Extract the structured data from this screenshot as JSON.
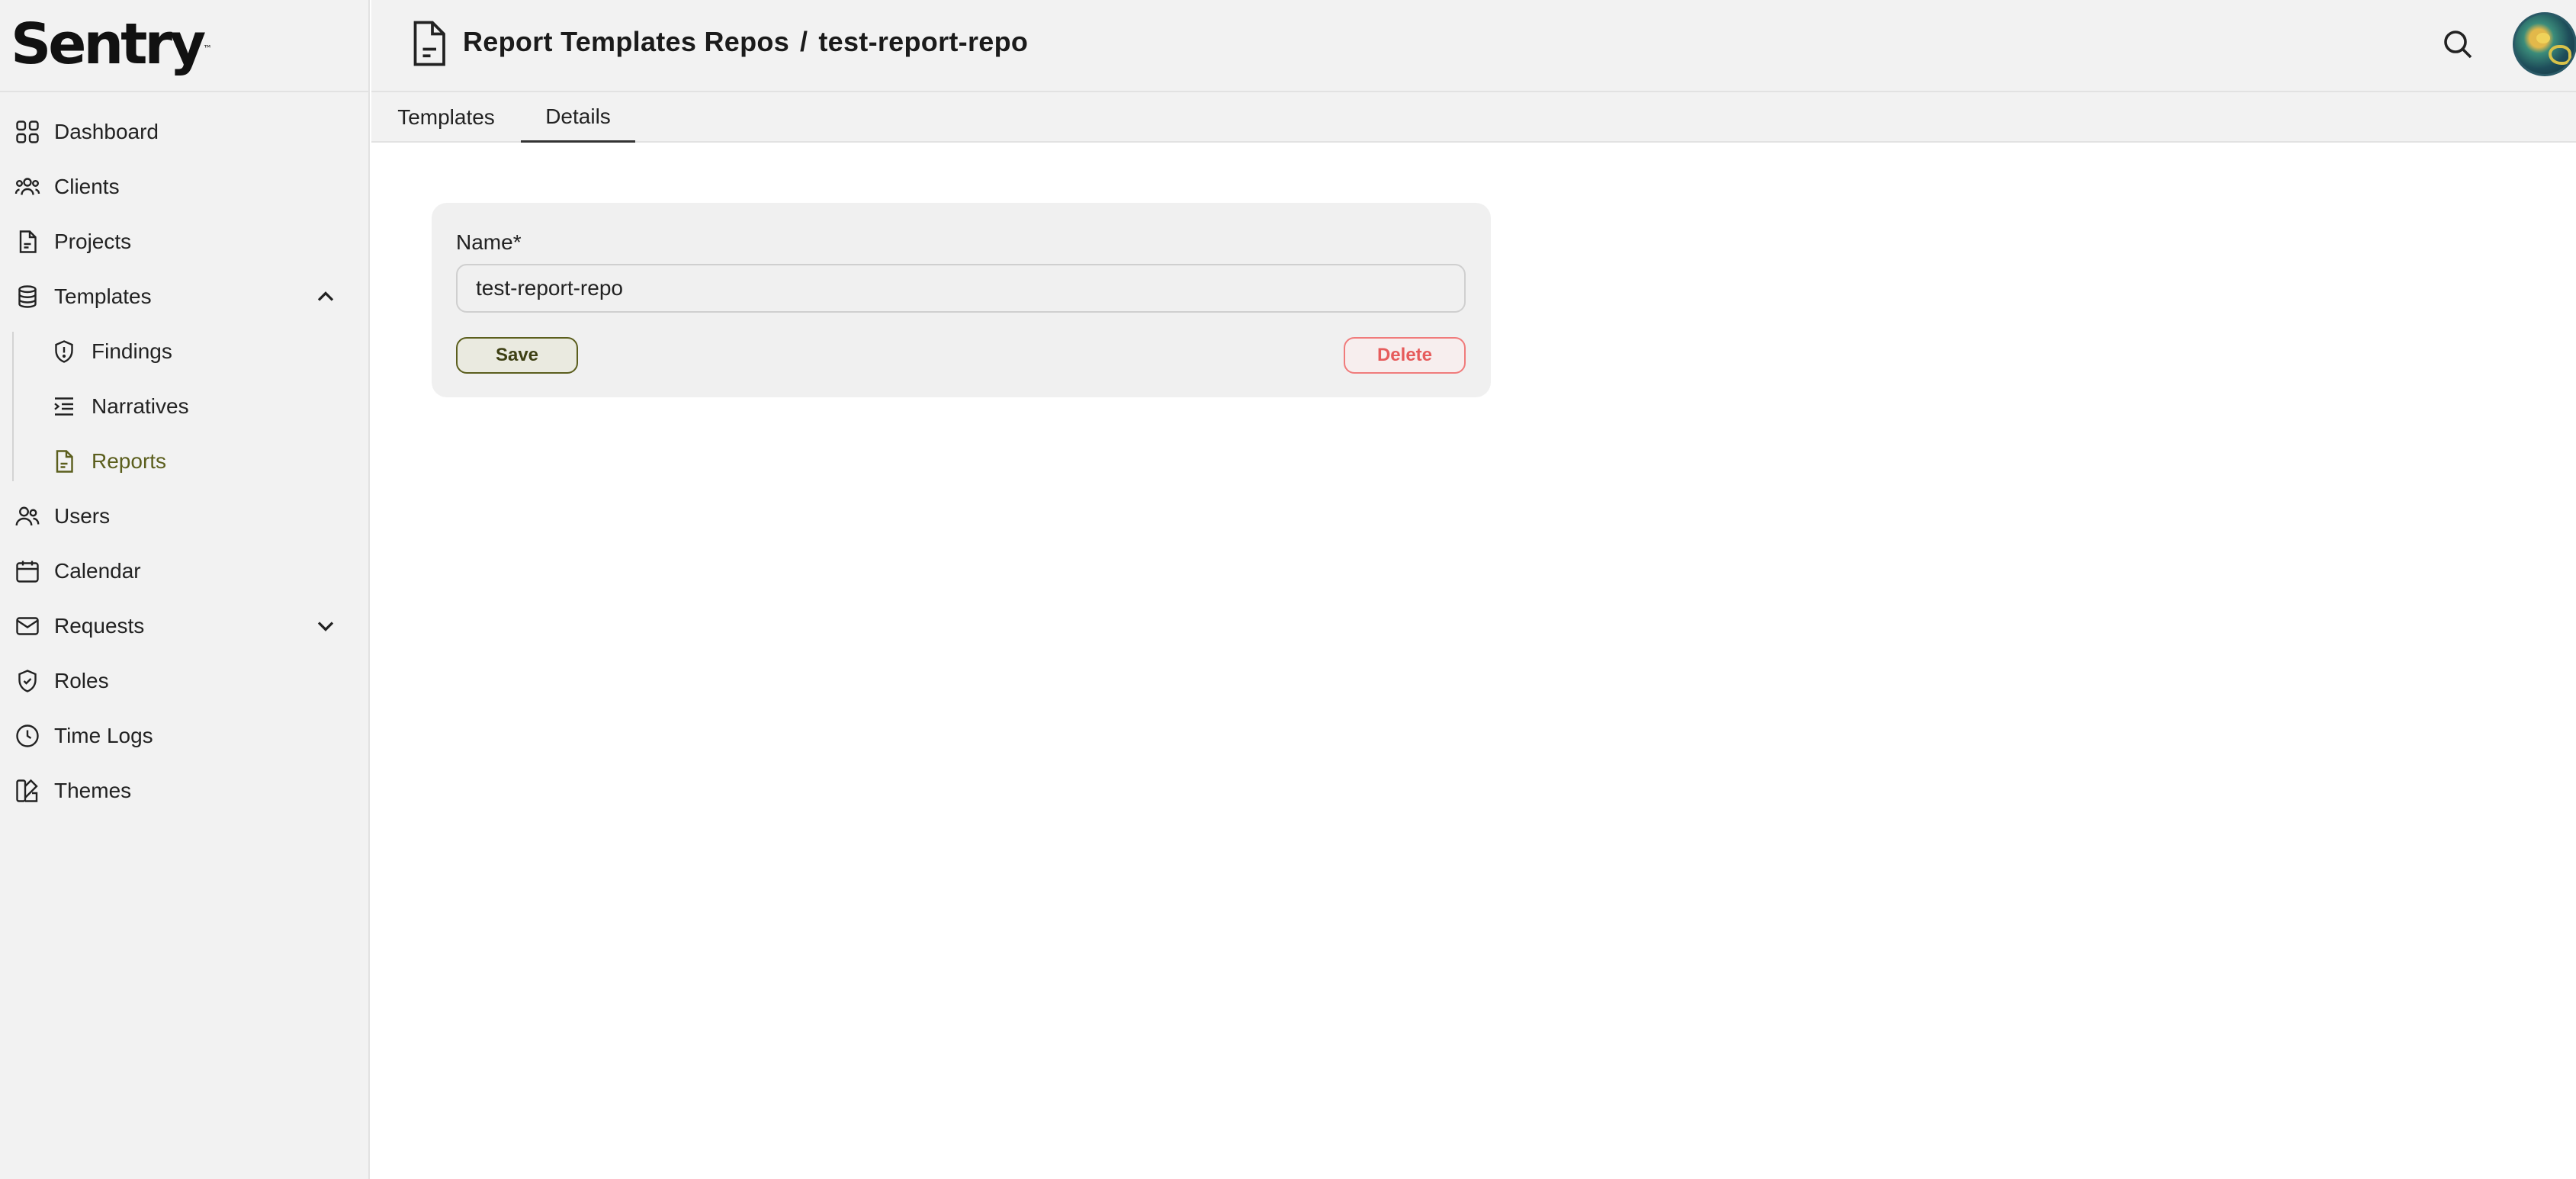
{
  "app": {
    "logo_text": "Sentry",
    "logo_trademark": "™"
  },
  "sidebar": {
    "items": [
      {
        "label": "Dashboard",
        "icon": "grid-icon"
      },
      {
        "label": "Clients",
        "icon": "users-group-icon"
      },
      {
        "label": "Projects",
        "icon": "file-icon"
      },
      {
        "label": "Templates",
        "icon": "database-icon",
        "expanded": true,
        "children": [
          {
            "label": "Findings",
            "icon": "shield-alert-icon"
          },
          {
            "label": "Narratives",
            "icon": "list-indent-icon"
          },
          {
            "label": "Reports",
            "icon": "file-text-icon",
            "active": true
          }
        ]
      },
      {
        "label": "Users",
        "icon": "users-icon"
      },
      {
        "label": "Calendar",
        "icon": "calendar-icon"
      },
      {
        "label": "Requests",
        "icon": "mail-icon",
        "expanded": false
      },
      {
        "label": "Roles",
        "icon": "shield-check-icon"
      },
      {
        "label": "Time Logs",
        "icon": "clock-icon"
      },
      {
        "label": "Themes",
        "icon": "swatch-icon"
      }
    ]
  },
  "header": {
    "breadcrumb_parent": "Report Templates Repos",
    "breadcrumb_separator": "/",
    "breadcrumb_current": "test-report-repo"
  },
  "tabs": [
    {
      "label": "Templates",
      "active": false
    },
    {
      "label": "Details",
      "active": true
    }
  ],
  "form": {
    "name_label": "Name*",
    "name_value": "test-report-repo",
    "save_label": "Save",
    "delete_label": "Delete"
  },
  "colors": {
    "accent": "#5b5e1d",
    "danger": "#e65c5c",
    "sidebar_bg": "#f2f2f2"
  }
}
